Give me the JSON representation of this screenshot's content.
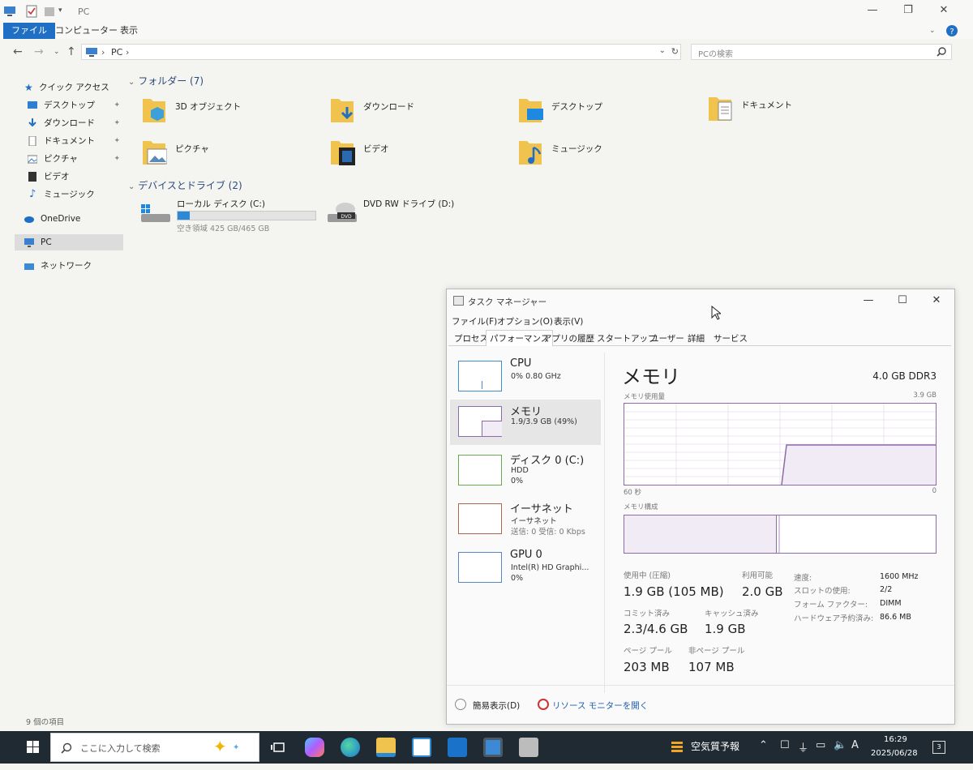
{
  "explorer": {
    "title": "PC",
    "ribbon_tabs": [
      "ファイル",
      "コンピューター",
      "表示"
    ],
    "address": "PC",
    "address_sep": "›",
    "search_placeholder": "PCの検索",
    "nav": {
      "quick_access": "クイック アクセス",
      "items": [
        "デスクトップ",
        "ダウンロード",
        "ドキュメント",
        "ピクチャ",
        "ビデオ",
        "ミュージック"
      ],
      "onedrive": "OneDrive",
      "pc": "PC",
      "network": "ネットワーク"
    },
    "folders_header": "フォルダー (7)",
    "folders": [
      "3D オブジェクト",
      "ダウンロード",
      "デスクトップ",
      "ドキュメント",
      "ピクチャ",
      "ビデオ",
      "ミュージック"
    ],
    "drives_header": "デバイスとドライブ (2)",
    "drives": [
      {
        "label": "ローカル ディスク (C:)",
        "sub": "空き領域 425 GB/465 GB",
        "used_fraction": 0.086
      },
      {
        "label": "DVD RW ドライブ (D:)"
      }
    ],
    "status": "9 個の項目"
  },
  "taskmgr": {
    "title": "タスク マネージャー",
    "menus": [
      "ファイル(F)",
      "オプション(O)",
      "表示(V)"
    ],
    "tabs": [
      "プロセス",
      "パフォーマンス",
      "アプリの履歴",
      "スタートアップ",
      "ユーザー",
      "詳細",
      "サービス"
    ],
    "side": [
      {
        "name": "CPU",
        "sub1": "0% 0.80 GHz",
        "sub2": ""
      },
      {
        "name": "メモリ",
        "sub1": "1.9/3.9 GB (49%)",
        "sub2": ""
      },
      {
        "name": "ディスク 0 (C:)",
        "sub1": "HDD",
        "sub2": "0%"
      },
      {
        "name": "イーサネット",
        "sub1": "イーサネット",
        "sub2": "送信: 0 受信: 0 Kbps"
      },
      {
        "name": "GPU 0",
        "sub1": "Intel(R) HD Graphi...",
        "sub2": "0%"
      }
    ],
    "memory": {
      "title": "メモリ",
      "type": "4.0 GB DDR3",
      "usage_label": "メモリ使用量",
      "usage_max": "3.9 GB",
      "time_left": "60 秒",
      "time_right": "0",
      "composition_label": "メモリ構成",
      "in_use_label": "使用中 (圧縮)",
      "in_use_value": "1.9 GB (105 MB)",
      "available_label": "利用可能",
      "available_value": "2.0 GB",
      "committed_label": "コミット済み",
      "committed_value": "2.3/4.6 GB",
      "cached_label": "キャッシュ済み",
      "cached_value": "1.9 GB",
      "paged_label": "ページ プール",
      "paged_value": "203 MB",
      "nonpaged_label": "非ページ プール",
      "nonpaged_value": "107 MB",
      "speed_label": "速度:",
      "speed_value": "1600 MHz",
      "slots_label": "スロットの使用:",
      "slots_value": "2/2",
      "form_label": "フォーム ファクター:",
      "form_value": "DIMM",
      "reserved_label": "ハードウェア予約済み:",
      "reserved_value": "86.6 MB"
    },
    "fewer_details": "簡易表示(D)",
    "resource_monitor": "リソース モニターを開く"
  },
  "taskbar": {
    "search_placeholder": "ここに入力して検索",
    "weather": "空気質予報",
    "ime": "A",
    "time": "16:29",
    "date": "2025/06/28",
    "notifications": "3"
  },
  "colors": {
    "accent": "#1f6fc4",
    "mem_purple": "#8e6aa8",
    "cpu_blue": "#3c8ed0",
    "disk_green": "#6aaa4e",
    "eth_red": "#b0654a",
    "gpu_blue": "#5a86c2"
  }
}
